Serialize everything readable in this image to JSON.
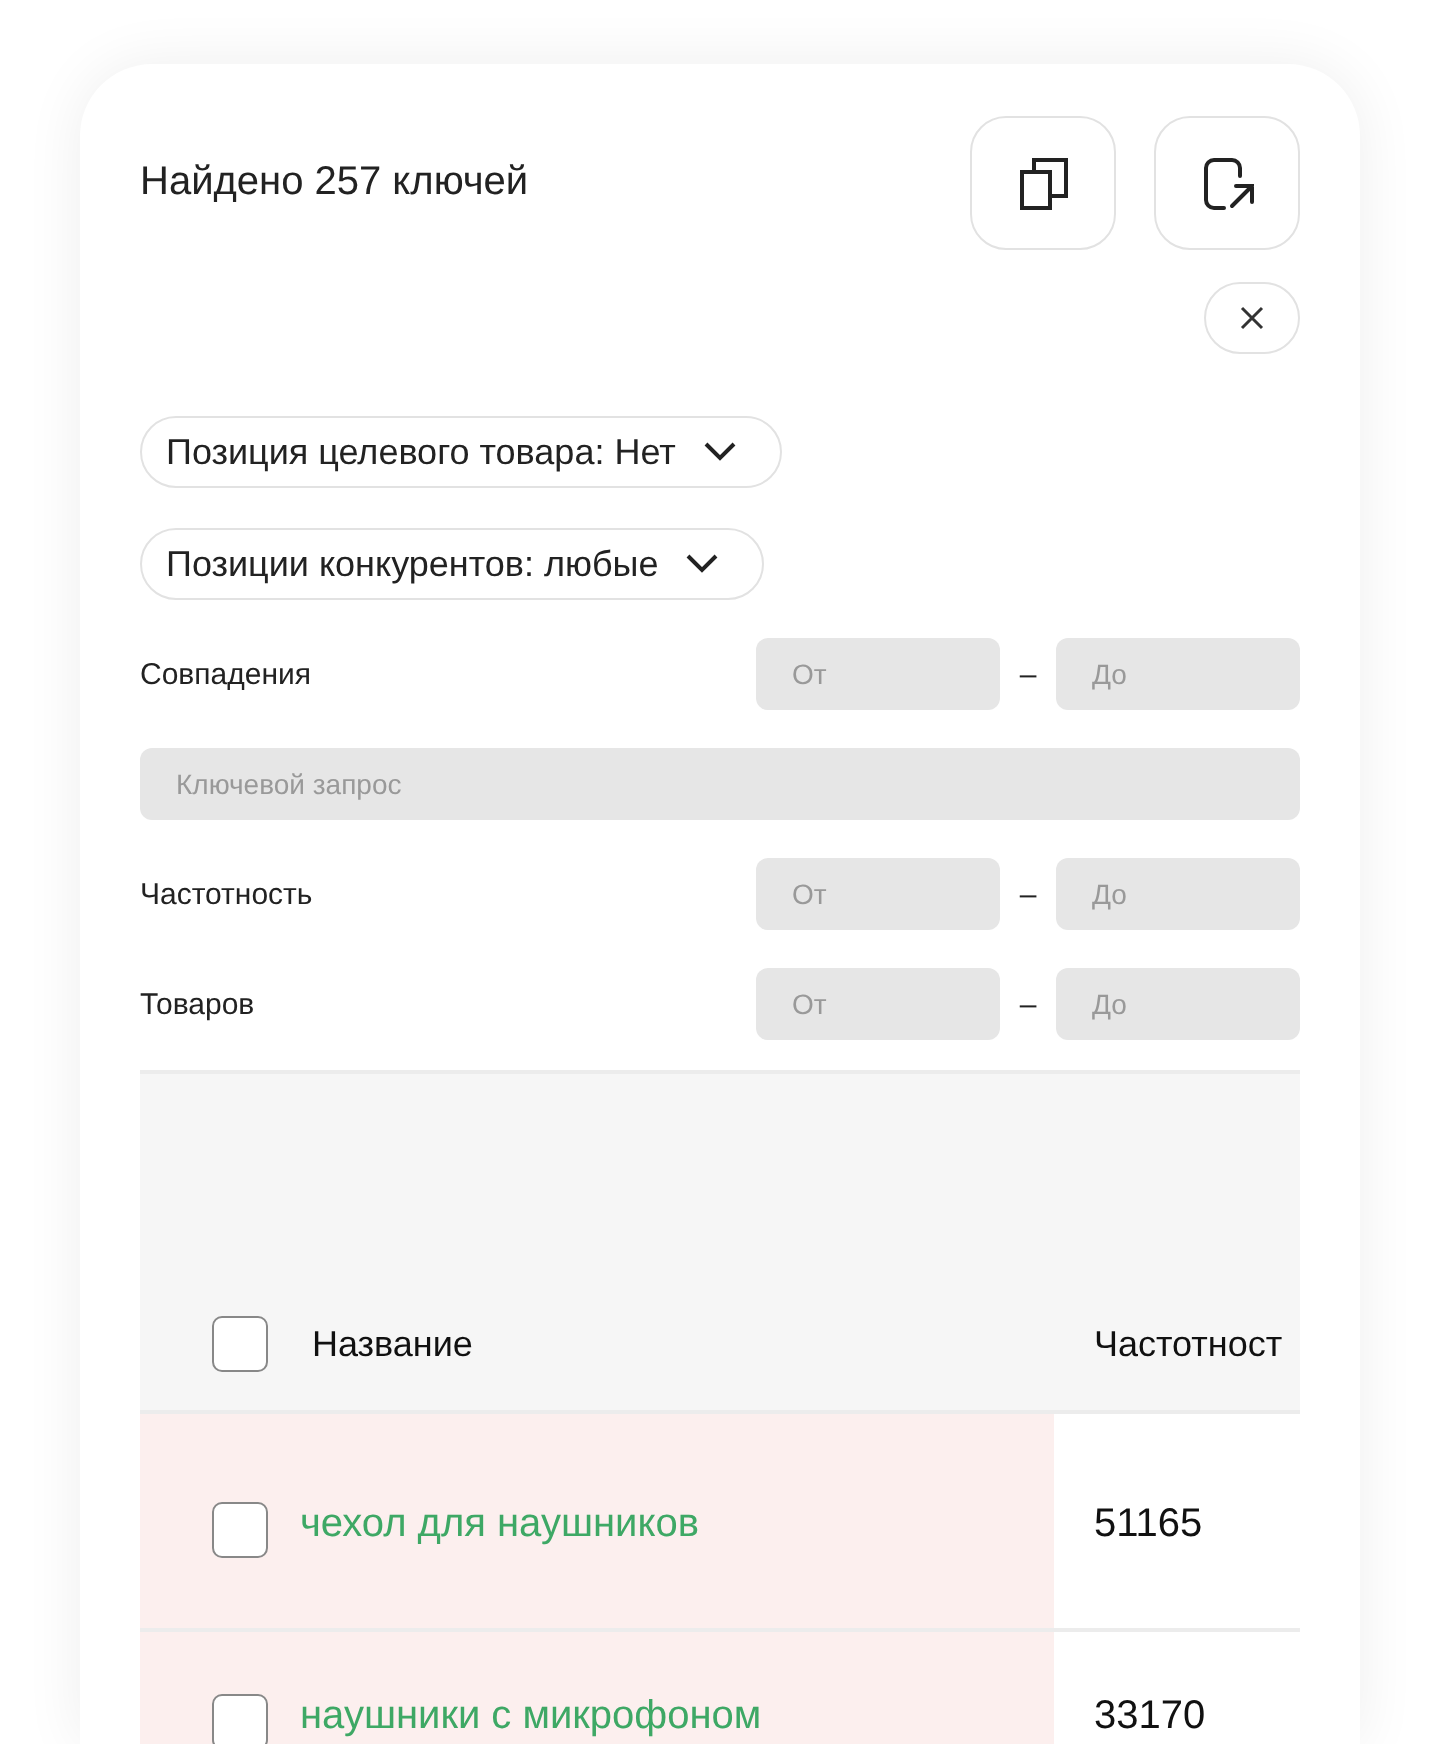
{
  "header": {
    "title": "Найдено 257 ключей"
  },
  "dropdowns": [
    {
      "label": "Позиция целевого товара: Нет"
    },
    {
      "label": "Позиции конкурентов: любые"
    }
  ],
  "filters": [
    {
      "kind": "range",
      "label": "Совпадения",
      "from_placeholder": "От",
      "separator": "–",
      "to_placeholder": "До"
    },
    {
      "kind": "text",
      "placeholder": "Ключевой запрос"
    },
    {
      "kind": "range",
      "label": "Частотность",
      "from_placeholder": "От",
      "separator": "–",
      "to_placeholder": "До"
    },
    {
      "kind": "range",
      "label": "Товаров",
      "from_placeholder": "От",
      "separator": "–",
      "to_placeholder": "До"
    }
  ],
  "table": {
    "select_all_checked": false,
    "columns": [
      "Название",
      "Частотност"
    ],
    "rows": [
      {
        "name": "чехол для наушников",
        "frequency": "51165",
        "checked": false,
        "highlighted": true
      },
      {
        "name": "наушники с микрофоном",
        "frequency": "33170",
        "checked": false,
        "highlighted": true
      }
    ]
  }
}
